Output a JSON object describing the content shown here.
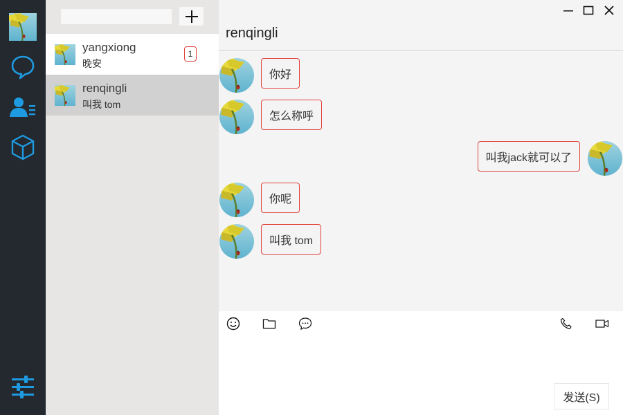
{
  "nav": {
    "icons": [
      "avatar",
      "chat-icon",
      "contacts-icon",
      "cube-icon",
      "settings-sliders-icon"
    ],
    "accent_color": "#1e9be0",
    "background_color": "#24282f"
  },
  "search": {
    "value": "",
    "placeholder": ""
  },
  "conversations": [
    {
      "name": "yangxiong",
      "preview": "晚安",
      "badge": "1",
      "selected": false
    },
    {
      "name": "renqingli",
      "preview": "叫我 tom",
      "selected": true
    }
  ],
  "chat": {
    "title": "renqingli",
    "messages": [
      {
        "side": "left",
        "text": "你好"
      },
      {
        "side": "left",
        "text": "怎么称呼"
      },
      {
        "side": "right",
        "text": "叫我jack就可以了"
      },
      {
        "side": "left",
        "text": "你呢"
      },
      {
        "side": "left",
        "text": "叫我 tom"
      }
    ]
  },
  "composer": {
    "tools_left": [
      "emoji-icon",
      "folder-icon",
      "chat-bubble-icon"
    ],
    "tools_right": [
      "phone-icon",
      "video-icon"
    ],
    "input_value": "",
    "send_label": "发送(S)"
  },
  "colors": {
    "bubble_border": "#e2413b",
    "badge_border": "#e2413b"
  }
}
